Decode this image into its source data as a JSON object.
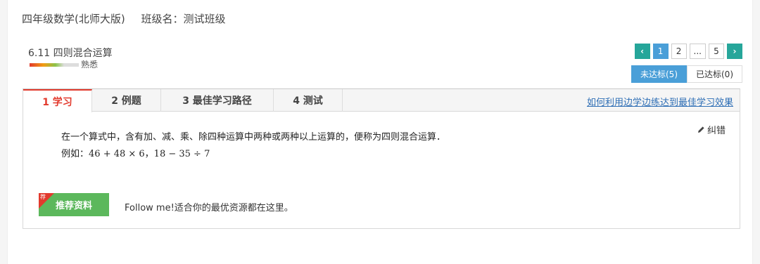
{
  "header": {
    "course": "四年级数学(北师大版)",
    "class_name": "班级名：测试班级"
  },
  "lesson": {
    "title": "6.11 四则混合运算",
    "mastery_label": "熟悉",
    "mastery_level": 0.7
  },
  "pager": {
    "prev": "‹",
    "pages": [
      "1",
      "2",
      "...",
      "5"
    ],
    "current": "1",
    "next": "›"
  },
  "status_tabs": {
    "unmet": "未达标(5)",
    "met": "已达标(0)"
  },
  "tabs": [
    {
      "label": "1 学习"
    },
    {
      "label": "2 例题"
    },
    {
      "label": "3 最佳学习路径"
    },
    {
      "label": "4 测试"
    }
  ],
  "help_link": "如何利用边学边练达到最佳学习效果",
  "correct_label": "纠错",
  "content": {
    "definition": "在一个算式中，含有加、减、乘、除四种运算中两种或两种以上运算的，便称为四则混合运算．",
    "example_prefix": "例如：",
    "example_math": "46 + 48 × 6，18 − 35 ÷ 7"
  },
  "recommend": {
    "corner": "荐",
    "button": "推荐资料",
    "tagline": "Follow me!适合你的最优资源都在这里。"
  },
  "colors": {
    "accent_red": "#e23a2d",
    "teal": "#26a69a",
    "blue": "#4a9fd8",
    "green": "#5cb85c",
    "link": "#2e6eb5"
  }
}
